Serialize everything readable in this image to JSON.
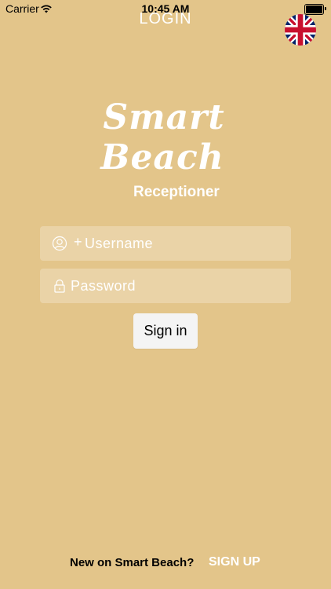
{
  "status": {
    "carrier": "Carrier",
    "time": "10:45 AM"
  },
  "nav": {
    "title": "LOGIN",
    "language_icon": "uk-flag-icon"
  },
  "logo": {
    "line1": "Smart",
    "line2": "Beach",
    "subtitle": "Receptioner"
  },
  "form": {
    "username_placeholder": "Username",
    "username_value": "",
    "username_prefix": "+",
    "password_placeholder": "Password",
    "password_value": "",
    "signin_label": "Sign in"
  },
  "footer": {
    "prompt": "New on Smart Beach?",
    "signup_label": "SIGN UP"
  },
  "colors": {
    "background": "#e3c58a",
    "field_bg": "rgba(255,255,255,0.25)",
    "button_bg": "#f4f4f4",
    "text_light": "#ffffff"
  }
}
